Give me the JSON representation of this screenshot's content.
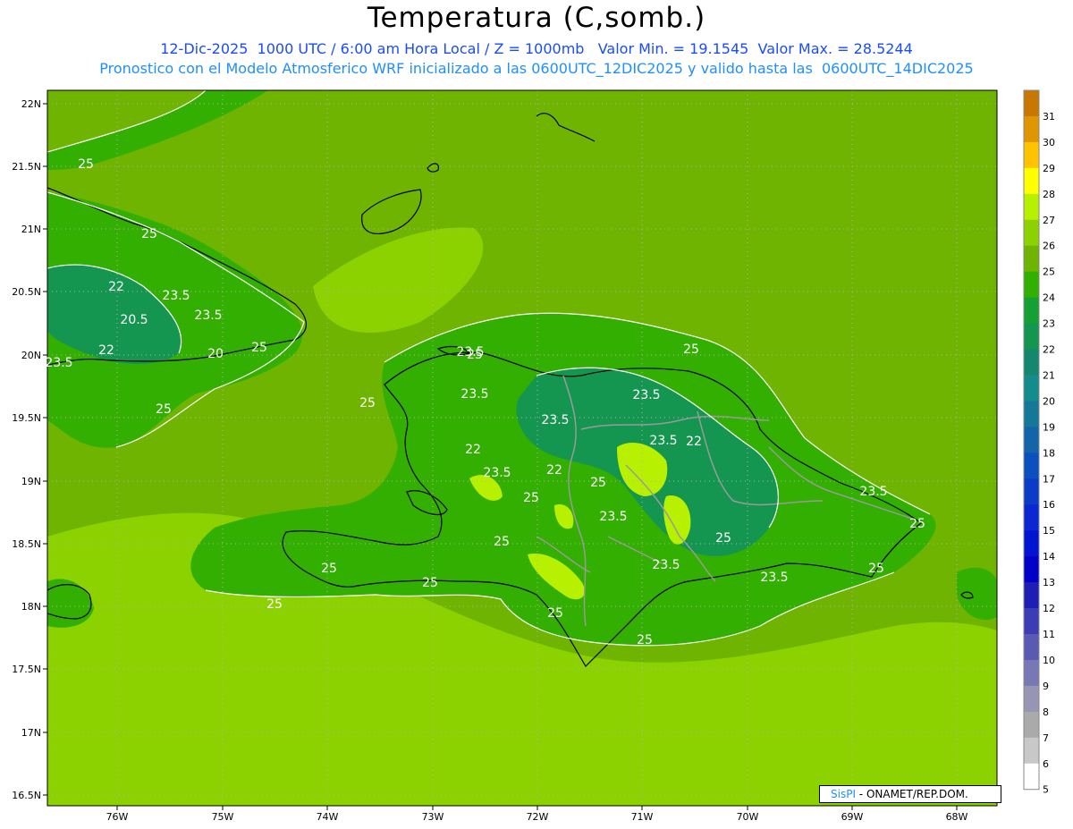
{
  "header": {
    "title": "Temperatura (C,somb.)",
    "line1": "12-Dic-2025  1000 UTC / 6:00 am Hora Local / Z = 1000mb   Valor Min. = 19.1545  Valor Max. = 28.5244",
    "line2": "Pronostico con el Modelo Atmosferico WRF inicializado a las 0600UTC_12DIC2025 y valido hasta las  0600UTC_14DIC2025"
  },
  "axes": {
    "lat_labels": [
      "22N",
      "21.5N",
      "21N",
      "20.5N",
      "20N",
      "19.5N",
      "19N",
      "18.5N",
      "18N",
      "17.5N",
      "17N",
      "16.5N"
    ],
    "lon_labels": [
      "76W",
      "75W",
      "74W",
      "73W",
      "72W",
      "71W",
      "70W",
      "69W",
      "68W"
    ]
  },
  "contour_labels": [
    "25",
    "25",
    "22",
    "23.5",
    "23.5",
    "20.5",
    "22",
    "20",
    "25",
    "23.5",
    "25",
    "25",
    "25",
    "23.5",
    "23.5",
    "23.5",
    "23.5",
    "22",
    "22",
    "22",
    "23.5",
    "25",
    "25",
    "23.5",
    "25",
    "23.5",
    "23.5",
    "23.5",
    "23.5",
    "25",
    "25",
    "25",
    "25",
    "25",
    "25",
    "25",
    "25",
    "25"
  ],
  "colorbar": {
    "labels": [
      "31",
      "30",
      "29",
      "28",
      "27",
      "26",
      "25",
      "24",
      "23",
      "22",
      "21",
      "20",
      "19",
      "18",
      "17",
      "16",
      "15",
      "14",
      "13",
      "12",
      "11",
      "10",
      "9",
      "8",
      "7",
      "6",
      "5"
    ],
    "colors": [
      "#c87800",
      "#e09600",
      "#ffc300",
      "#ffff00",
      "#b7f000",
      "#8cd200",
      "#6eb400",
      "#32af00",
      "#14a032",
      "#149650",
      "#14876e",
      "#148c8c",
      "#147896",
      "#1464aa",
      "#0a50be",
      "#0a3cc8",
      "#0a28d2",
      "#0014d2",
      "#0000c8",
      "#1e1eb4",
      "#3c3cb4",
      "#5a5ab4",
      "#7878b4",
      "#9696b4",
      "#aaaaaa",
      "#c8c8c8",
      "#ffffff"
    ]
  },
  "credit": {
    "brand": "SisPI",
    "text": " - ONAMET/REP.DOM."
  },
  "field_colors": {
    "sea": "#6eb400",
    "south_sea": "#8cd200",
    "land": "#32af00",
    "cool": "#149650",
    "warm": "#b7f000"
  }
}
